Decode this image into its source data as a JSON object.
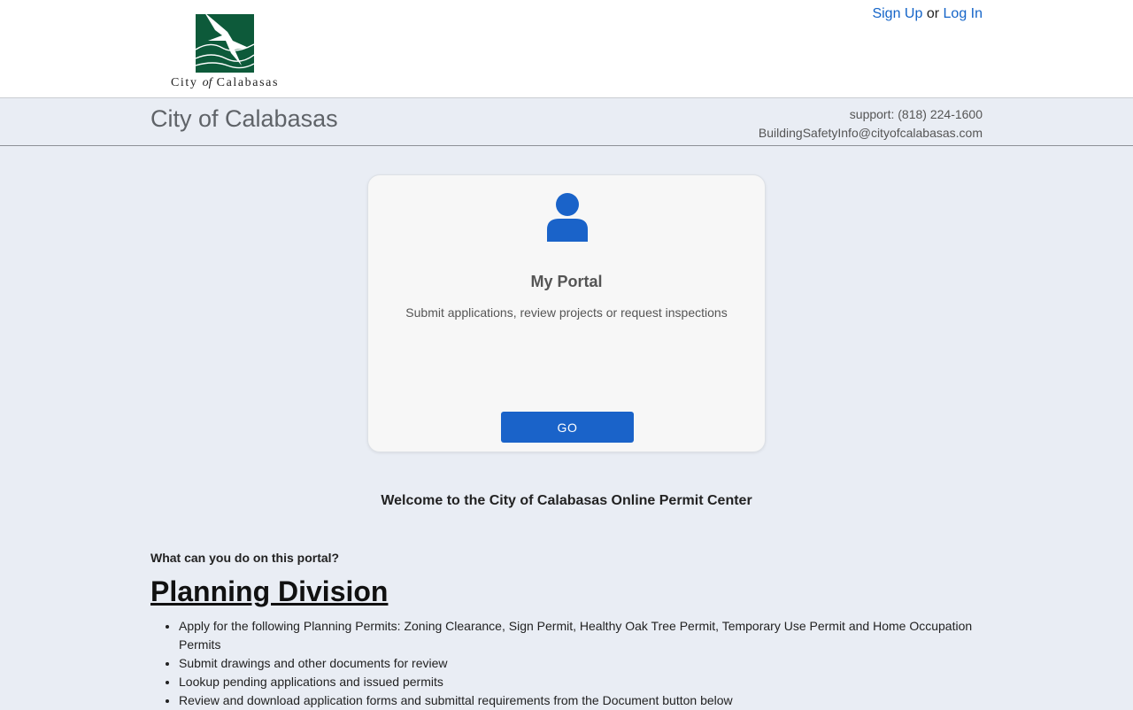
{
  "header": {
    "logo": {
      "city_word": "City",
      "of_word": "of",
      "name_word": "Calabasas"
    },
    "auth": {
      "signup_label": "Sign Up",
      "separator": "or",
      "login_label": "Log In"
    }
  },
  "subheader": {
    "title": "City of Calabasas",
    "support": "support: (818) 224-1600",
    "email": "BuildingSafetyInfo@cityofcalabasas.com"
  },
  "portal_card": {
    "icon": "user-icon",
    "title": "My Portal",
    "description": "Submit applications, review projects or request inspections",
    "button_label": "GO"
  },
  "welcome": "Welcome to the City of Calabasas Online Permit Center",
  "question": "What can you do on this portal?",
  "division_title": "Planning Division",
  "features": [
    "Apply for the following Planning Permits: Zoning Clearance, Sign Permit, Healthy Oak Tree Permit, Temporary Use Permit and Home Occupation Permits",
    "Submit drawings and other documents for review",
    "Lookup pending applications and issued permits",
    "Review and download application forms and submittal requirements from the Document button below"
  ],
  "colors": {
    "brand_green": "#0d5a3a",
    "link_blue": "#1464c8",
    "button_blue": "#1a63c9",
    "background": "#e9edf4"
  }
}
